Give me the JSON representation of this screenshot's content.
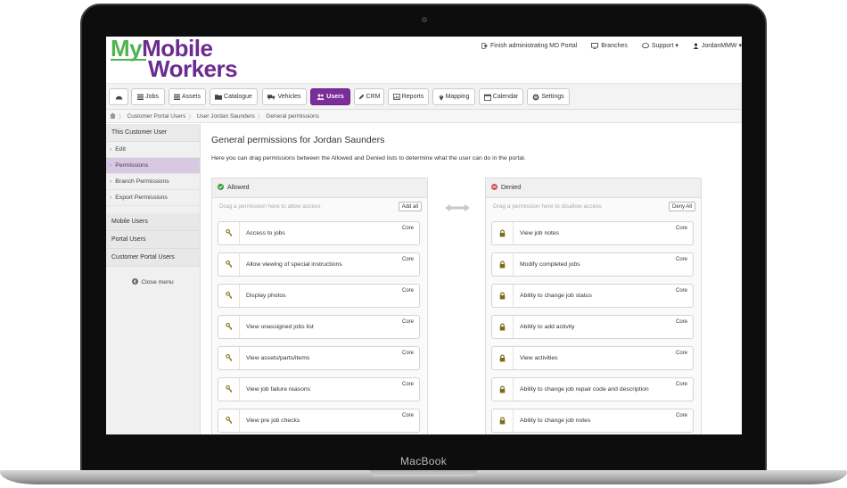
{
  "device": {
    "label": "MacBook"
  },
  "app": {
    "logo_line1": "My",
    "logo_line1b": "Mobile",
    "logo_line2": "Workers",
    "top_links": [
      {
        "icon": "exit-icon",
        "label": "Finish administrating MD Portal"
      },
      {
        "icon": "monitor-icon",
        "label": "Branches"
      },
      {
        "icon": "chat-icon",
        "label": "Support ▾"
      },
      {
        "icon": "user-icon",
        "label": "JordanMMW ▾"
      }
    ]
  },
  "nav": [
    {
      "icon": "dashboard-icon",
      "label": ""
    },
    {
      "icon": "list-icon",
      "label": "Jobs"
    },
    {
      "icon": "list-icon",
      "label": "Assets"
    },
    {
      "icon": "folder-icon",
      "label": "Catalogue"
    },
    {
      "icon": "truck-icon",
      "label": "Vehicles"
    },
    {
      "icon": "users-icon",
      "label": "Users",
      "active": true
    },
    {
      "icon": "pencil-icon",
      "label": "CRM"
    },
    {
      "icon": "chart-icon",
      "label": "Reports"
    },
    {
      "icon": "pin-icon",
      "label": "Mapping"
    },
    {
      "icon": "calendar-icon",
      "label": "Calendar"
    },
    {
      "icon": "gear-icon",
      "label": "Settings"
    }
  ],
  "breadcrumb": [
    "Customer Portal Users",
    "User Jordan Saunders",
    "General permissions"
  ],
  "sidebar": {
    "header": "This Customer User",
    "items": [
      "Edit",
      "Permissions",
      "Branch Permissions",
      "Export Permissions"
    ],
    "selected": "Permissions",
    "groups": [
      "Mobile Users",
      "Portal Users",
      "Customer Portal Users"
    ],
    "close_label": "Close menu"
  },
  "main": {
    "title": "General permissions for Jordan Saunders",
    "description": "Here you can drag permissions between the Allowed and Denied lists to determine what the user can do in the portal."
  },
  "allowed": {
    "title": "Allowed",
    "drag_hint": "Drag a permission here to allow access",
    "button": "Add all",
    "items": [
      {
        "label": "Access to jobs",
        "tag": "Core"
      },
      {
        "label": "Allow viewing of special instructions",
        "tag": "Core"
      },
      {
        "label": "Display photos",
        "tag": "Core"
      },
      {
        "label": "View unassigned jobs list",
        "tag": "Core"
      },
      {
        "label": "View assets/parts/items",
        "tag": "Core"
      },
      {
        "label": "View job failure reasons",
        "tag": "Core"
      },
      {
        "label": "View pre job checks",
        "tag": "Core"
      }
    ]
  },
  "denied": {
    "title": "Denied",
    "drag_hint": "Drag a permission here to disallow access",
    "button": "Deny All",
    "items": [
      {
        "label": "View job notes",
        "tag": "Core"
      },
      {
        "label": "Modify completed jobs",
        "tag": "Core"
      },
      {
        "label": "Ability to change job status",
        "tag": "Core"
      },
      {
        "label": "Ability to add activity",
        "tag": "Core"
      },
      {
        "label": "View activities",
        "tag": "Core"
      },
      {
        "label": "Ability to change job repair code and description",
        "tag": "Core"
      },
      {
        "label": "Ability to change job notes",
        "tag": "Core"
      }
    ]
  },
  "colors": {
    "brand_purple": "#7b2d9b",
    "brand_green": "#4fb34f",
    "allowed_green": "#3c9a3c",
    "denied_red": "#d9534f"
  }
}
